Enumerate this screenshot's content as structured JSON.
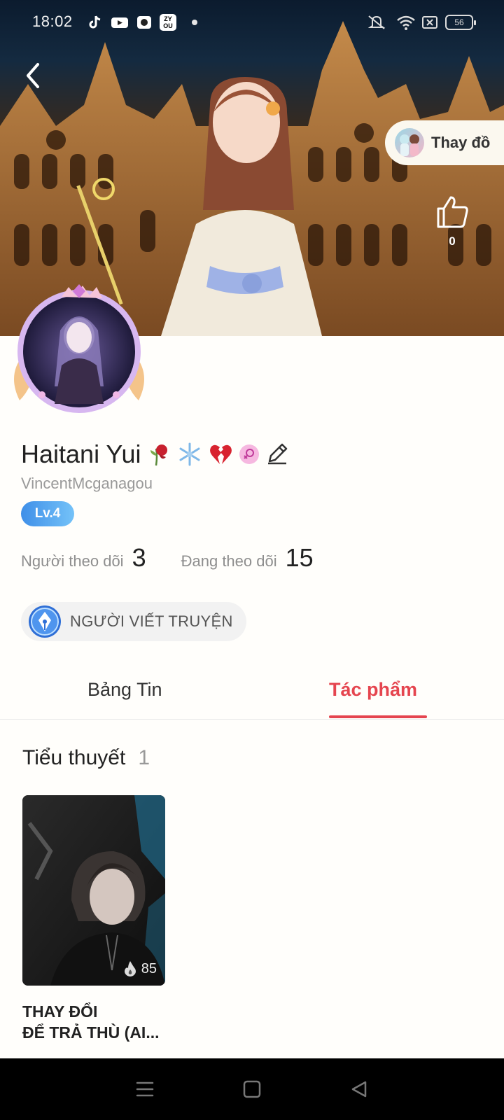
{
  "status_bar": {
    "time": "18:02",
    "battery": "56",
    "app_icons": [
      "tiktok-icon",
      "youtube-icon",
      "gallery-icon",
      "zyou-icon"
    ],
    "zyou_text": "ZY\nOU"
  },
  "banner": {
    "outfit_button_label": "Thay đồ",
    "like_count": "0"
  },
  "profile": {
    "name": "Haitani Yui",
    "username": "VincentMcganagou",
    "level": "Lv.4",
    "followers_label": "Người theo dõi",
    "followers_count": "3",
    "following_label": "Đang theo dõi",
    "following_count": "15",
    "role_label": "NGƯỜI VIẾT TRUYỆN"
  },
  "tabs": {
    "feed_label": "Bảng Tin",
    "works_label": "Tác phẩm",
    "active": "works"
  },
  "works": {
    "section_title": "Tiểu thuyết",
    "section_count": "1",
    "books": [
      {
        "title": "THAY ĐỔI\nĐỂ TRẢ THÙ (AI...",
        "views": "85"
      }
    ]
  },
  "colors": {
    "accent": "#e5454f",
    "level_badge": "#4a9aee",
    "nav_bar": "#000000"
  }
}
